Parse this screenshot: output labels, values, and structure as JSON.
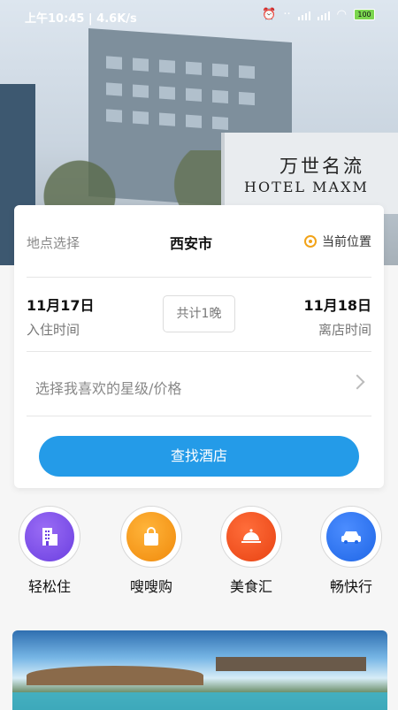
{
  "status_bar": {
    "time_speed": "上午10:45 | 4.6K/s",
    "battery": "100"
  },
  "hero": {
    "sign_cn": "万世名流",
    "sign_en": "HOTEL MAXM"
  },
  "booking": {
    "location_label": "地点选择",
    "city": "西安市",
    "current_location": "当前位置",
    "checkin_date": "11月17日",
    "checkin_label": "入住时间",
    "nights": "共计1晚",
    "checkout_date": "11月18日",
    "checkout_label": "离店时间",
    "filter_placeholder": "选择我喜欢的星级/价格",
    "search_button": "查找酒店"
  },
  "quick_menu": [
    {
      "label": "轻松住",
      "icon": "building-icon",
      "color": "#6b3fe0"
    },
    {
      "label": "嗖嗖购",
      "icon": "shopping-bag-icon",
      "color": "#f08a0c"
    },
    {
      "label": "美食汇",
      "icon": "food-cloche-icon",
      "color": "#e84313"
    },
    {
      "label": "畅快行",
      "icon": "car-icon",
      "color": "#1f66e6"
    }
  ],
  "colors": {
    "primary": "#249be8",
    "locate_icon": "#f2a318"
  }
}
